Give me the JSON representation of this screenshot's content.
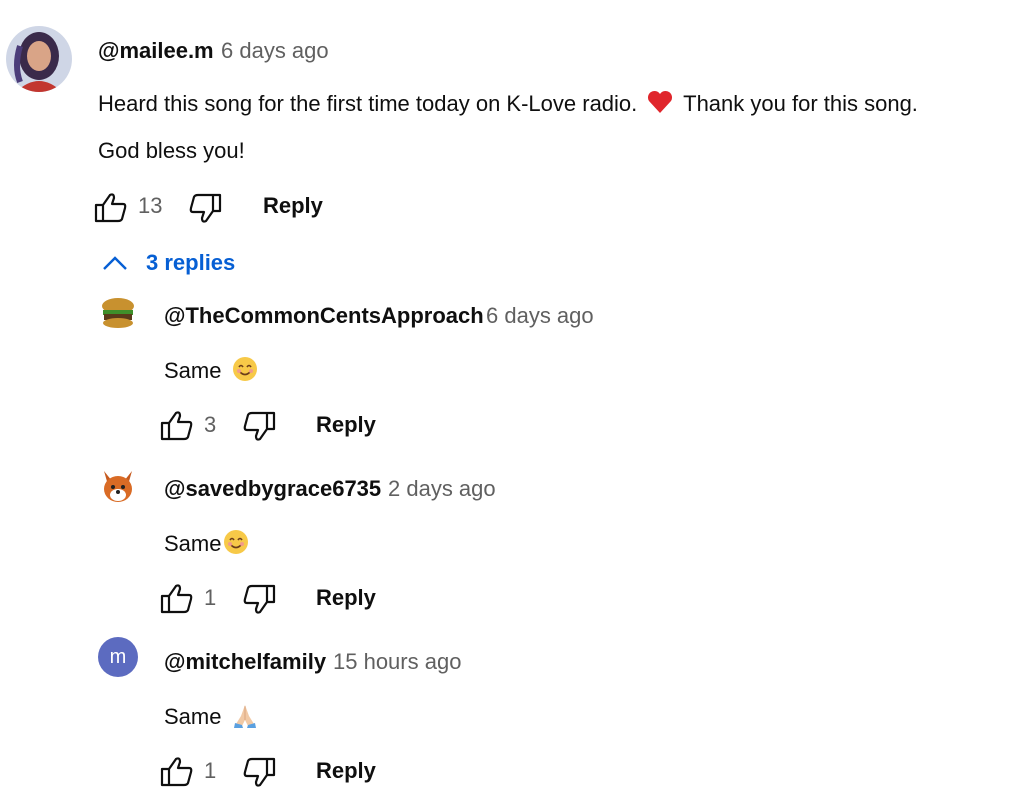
{
  "comment": {
    "handle": "@mailee.m",
    "time": "6 days ago",
    "text_line1_a": "Heard this song for the first time today on K-Love radio.",
    "text_line1_b": "Thank you for this song.",
    "text_line2": "God bless you!",
    "likes": "13",
    "reply_label": "Reply",
    "replies_toggle": "3 replies"
  },
  "replies": [
    {
      "handle": "@TheCommonCentsApproach",
      "time": "6 days ago",
      "text": "Same",
      "emoji": "smiling-face-emoji",
      "likes": "3",
      "reply_label": "Reply"
    },
    {
      "handle": "@savedbygrace6735",
      "time": "2 days ago",
      "text": "Same",
      "emoji": "smiling-face-emoji",
      "likes": "1",
      "reply_label": "Reply"
    },
    {
      "handle": "@mitchelfamily",
      "time": "15 hours ago",
      "text": "Same",
      "emoji": "folded-hands-emoji",
      "likes": "1",
      "reply_label": "Reply",
      "avatar_letter": "m"
    }
  ],
  "colors": {
    "link": "#065fd4",
    "muted": "#606060",
    "avatar_letter_bg": "#5c6bc0",
    "heart": "#e0262c"
  }
}
